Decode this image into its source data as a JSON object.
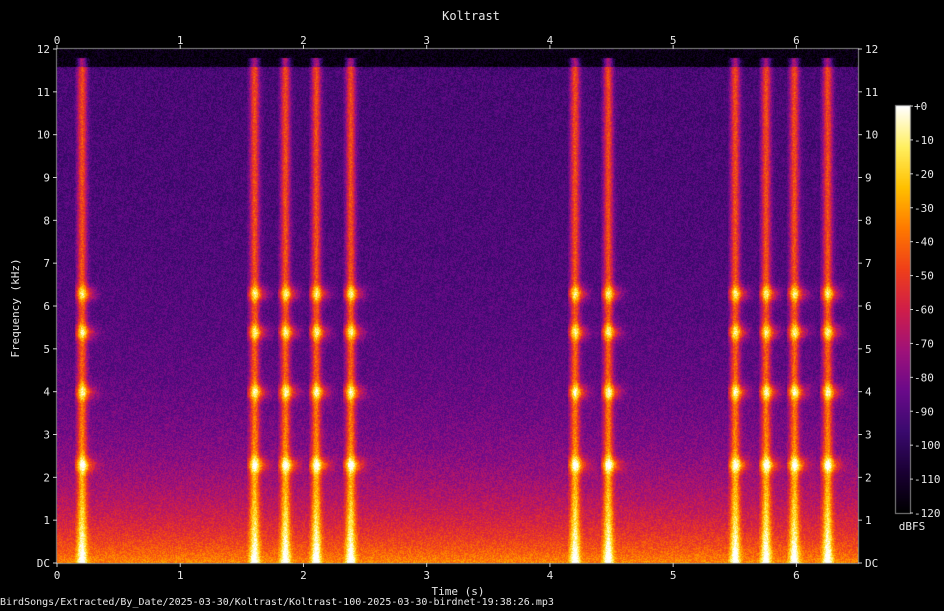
{
  "chart_data": {
    "type": "heatmap",
    "subtype": "spectrogram",
    "title": "Koltrast",
    "xlabel": "Time (s)",
    "ylabel": "Frequency (kHz)",
    "xlim": [
      0,
      6.5
    ],
    "ylim": [
      0,
      12
    ],
    "x_ticks": [
      "0",
      "1",
      "2",
      "3",
      "4",
      "5",
      "6"
    ],
    "y_ticks": [
      "DC",
      "1",
      "2",
      "3",
      "4",
      "5",
      "6",
      "7",
      "8",
      "9",
      "10",
      "11",
      "12"
    ],
    "colorbar": {
      "label": "dBFS",
      "range": [
        -120,
        0
      ],
      "ticks": [
        "+0",
        "-10",
        "-20",
        "-30",
        "-40",
        "-50",
        "-60",
        "-70",
        "-80",
        "-90",
        "-100",
        "-110",
        "-120"
      ],
      "colormap": [
        "#000000",
        "#1a0033",
        "#3a0a6e",
        "#6a0a8a",
        "#a0127a",
        "#d01e4a",
        "#f0401a",
        "#ff7a00",
        "#ffc000",
        "#fff060",
        "#ffffff"
      ]
    },
    "song_onsets_s": [
      0.2,
      1.6,
      1.85,
      2.1,
      2.38,
      4.2,
      4.47,
      5.5,
      5.75,
      5.98,
      6.25
    ],
    "dominant_bands_khz": [
      2.3,
      4.0,
      5.4,
      6.3
    ]
  },
  "footer": {
    "filepath": "BirdSongs/Extracted/By_Date/2025-03-30/Koltrast/Koltrast-100-2025-03-30-birdnet-19:38:26.mp3"
  }
}
